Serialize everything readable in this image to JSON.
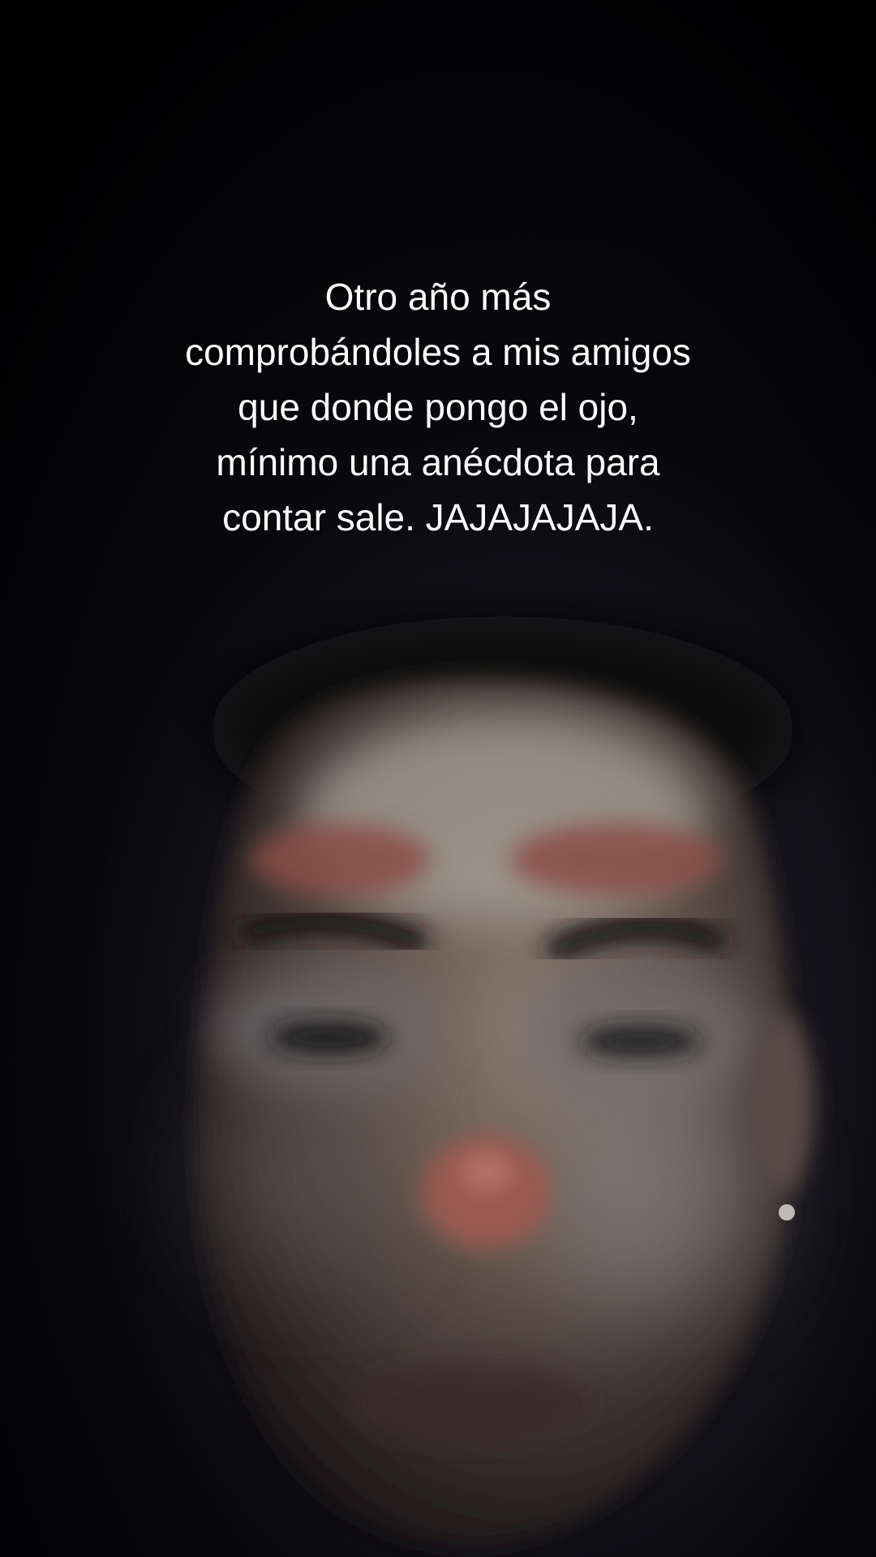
{
  "caption": {
    "lines": [
      "Otro año más",
      "comprobándoles a mis amigos",
      "que donde pongo el ojo,",
      "mínimo una anécdota para",
      "contar sale. JAJAJAJAJA."
    ]
  },
  "photo": {
    "subject": "selfie-face-with-clown-makeup",
    "colors": {
      "background": "#07070b",
      "skin": "#6e5e55",
      "makeup_white": "#bdb8b0",
      "makeup_red": "#8a5048",
      "hair": "#121014"
    }
  }
}
